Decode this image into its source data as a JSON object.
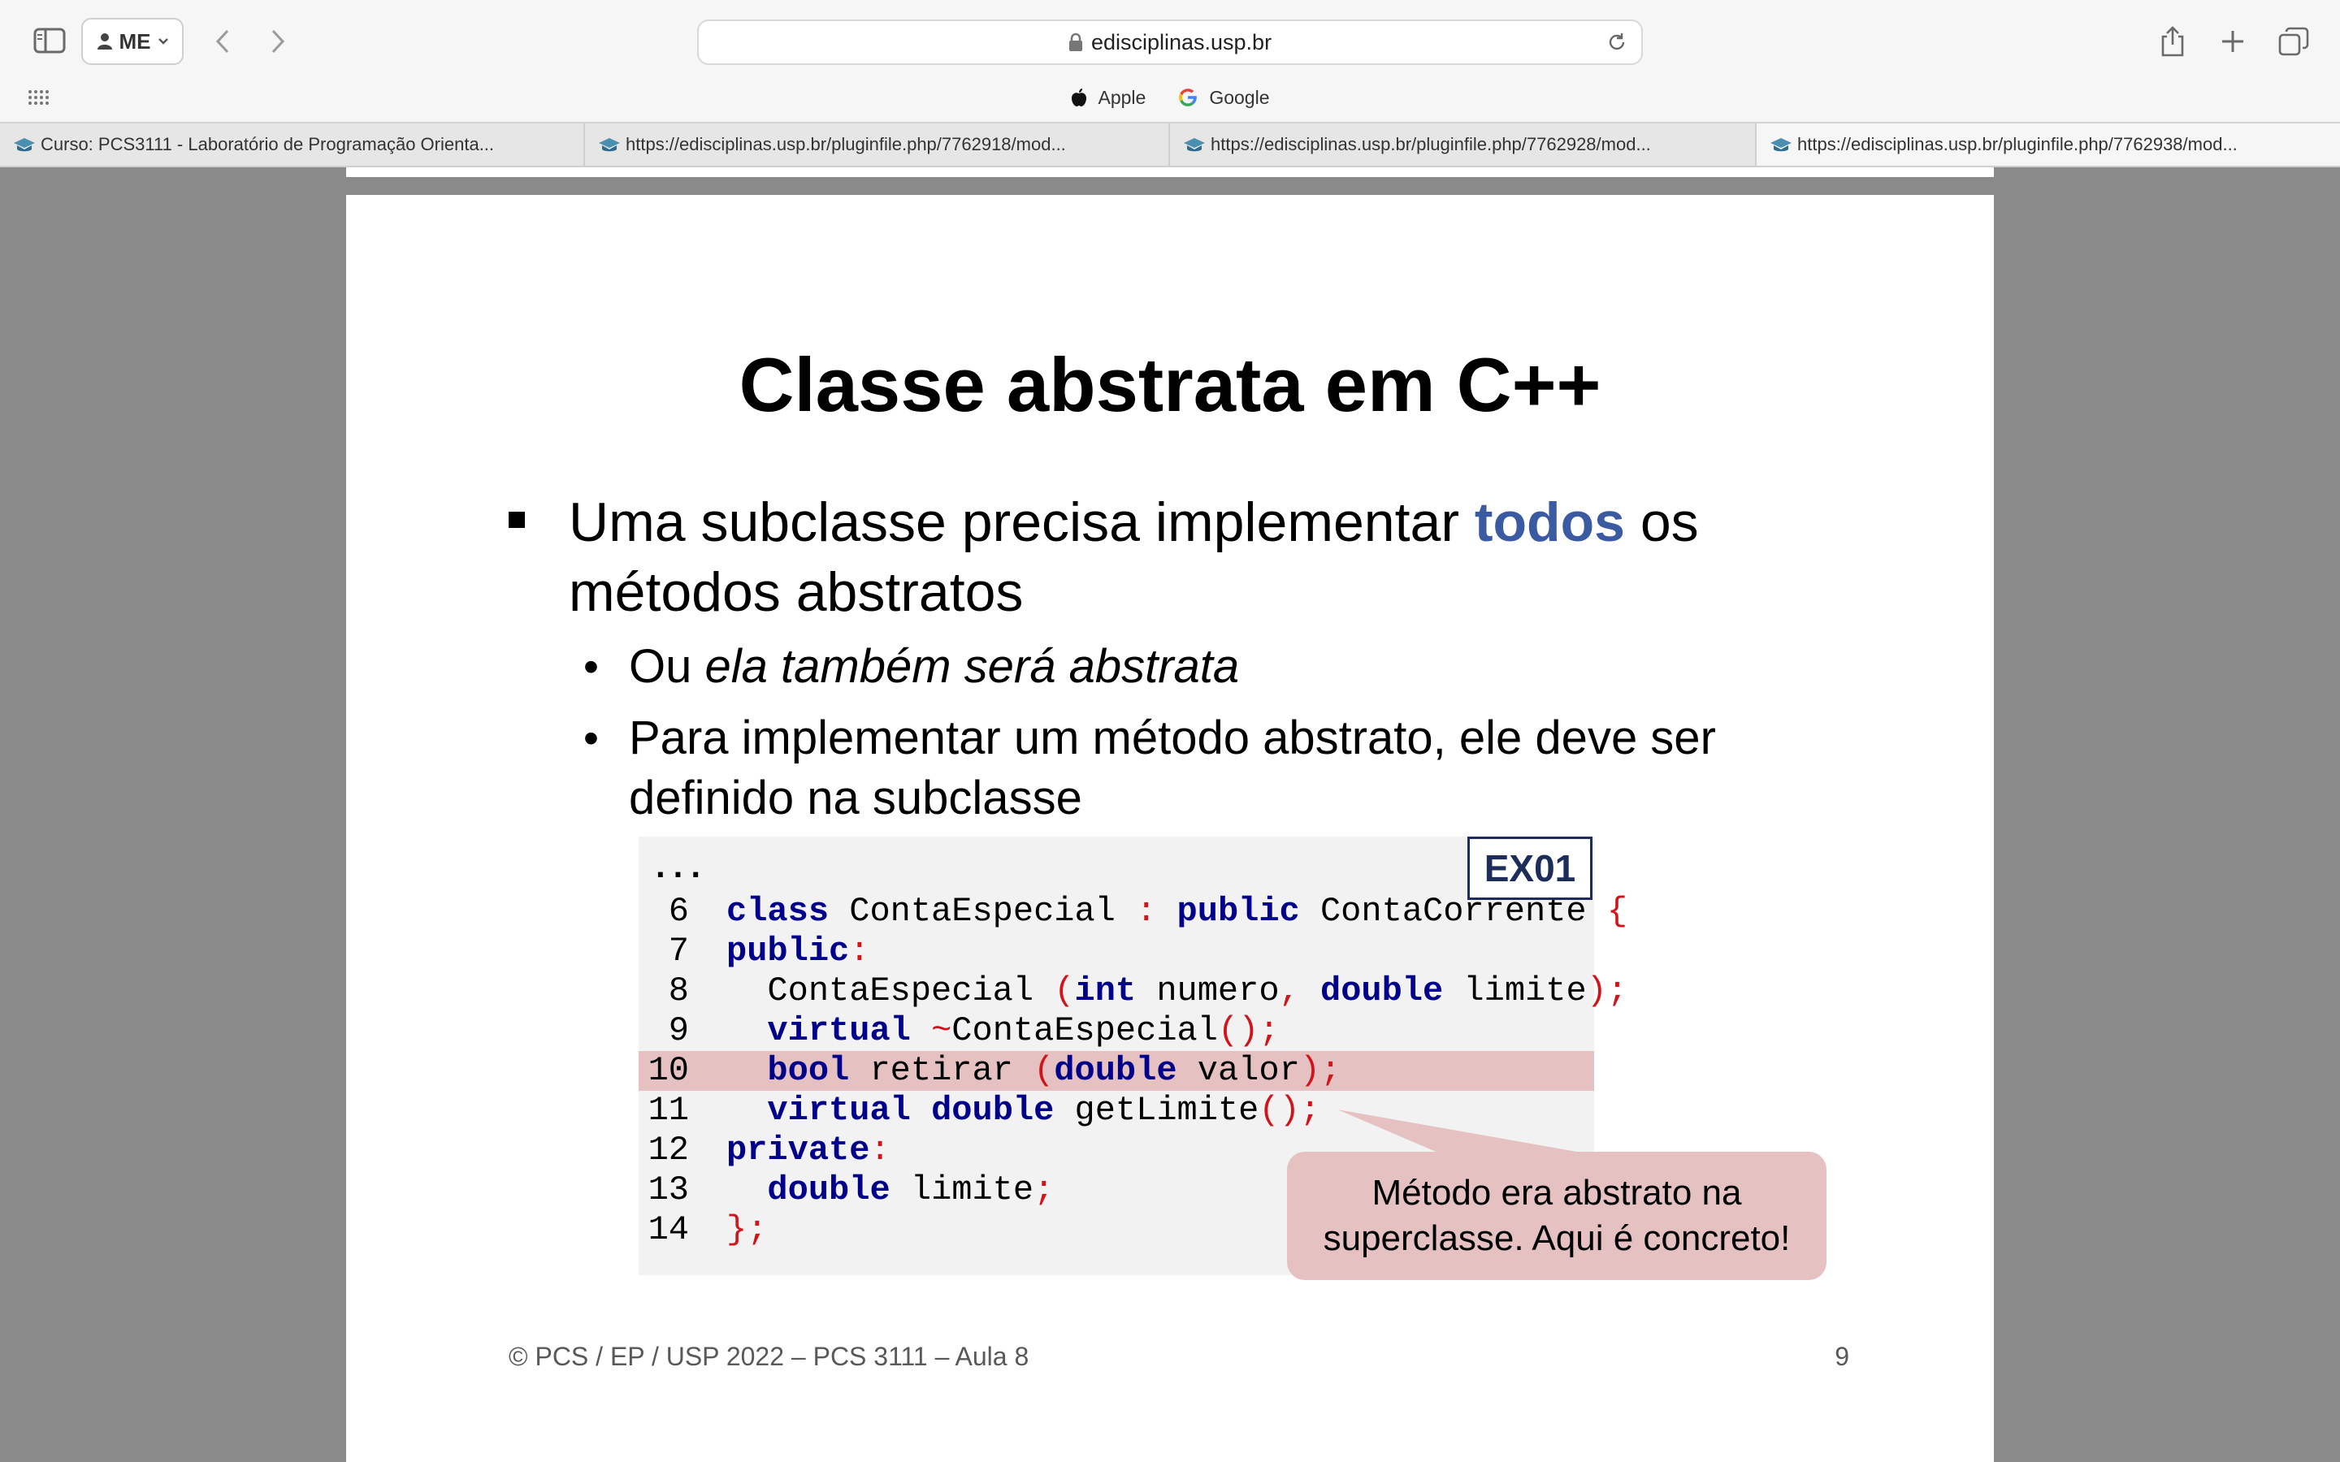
{
  "browser": {
    "profile_label": "ME",
    "url": "edisciplinas.usp.br",
    "favorites": [
      {
        "label": "Apple",
        "icon": "apple-icon"
      },
      {
        "label": "Google",
        "icon": "google-icon"
      }
    ],
    "tabs": [
      {
        "label": "Curso: PCS3111 - Laboratório de Programação Orienta...",
        "active": false
      },
      {
        "label": "https://edisciplinas.usp.br/pluginfile.php/7762918/mod...",
        "active": false
      },
      {
        "label": "https://edisciplinas.usp.br/pluginfile.php/7762928/mod...",
        "active": false
      },
      {
        "label": "https://edisciplinas.usp.br/pluginfile.php/7762938/mod...",
        "active": true
      }
    ]
  },
  "slide": {
    "title": "Classe abstrata em C++",
    "bullet1_pre": "Uma subclasse precisa implementar ",
    "bullet1_highlight": "todos",
    "bullet1_post": " os métodos abstratos",
    "bullet2_pre": "Ou ",
    "bullet2_italic": "ela também será abstrata",
    "bullet3": "Para implementar um método abstrato, ele deve ser definido na subclasse",
    "example_label": "EX01",
    "code_ellipsis": "...",
    "code_lines": [
      {
        "num": "6",
        "highlight": false,
        "tokens": [
          {
            "t": "class",
            "c": "kw"
          },
          {
            "t": " ContaEspecial "
          },
          {
            "t": ":",
            "c": "p"
          },
          {
            "t": " "
          },
          {
            "t": "public",
            "c": "kw"
          },
          {
            "t": " ContaCorrente "
          },
          {
            "t": "{",
            "c": "p"
          }
        ]
      },
      {
        "num": "7",
        "highlight": false,
        "tokens": [
          {
            "t": "public",
            "c": "kw"
          },
          {
            "t": ":",
            "c": "p"
          }
        ]
      },
      {
        "num": "8",
        "highlight": false,
        "tokens": [
          {
            "t": "  ContaEspecial "
          },
          {
            "t": "(",
            "c": "p"
          },
          {
            "t": "int",
            "c": "kw"
          },
          {
            "t": " numero"
          },
          {
            "t": ",",
            "c": "p"
          },
          {
            "t": " "
          },
          {
            "t": "double",
            "c": "kw"
          },
          {
            "t": " limite"
          },
          {
            "t": ");",
            "c": "p"
          }
        ]
      },
      {
        "num": "9",
        "highlight": false,
        "tokens": [
          {
            "t": "  "
          },
          {
            "t": "virtual",
            "c": "kw"
          },
          {
            "t": " "
          },
          {
            "t": "~",
            "c": "p"
          },
          {
            "t": "ContaEspecial"
          },
          {
            "t": "();",
            "c": "p"
          }
        ]
      },
      {
        "num": "10",
        "highlight": true,
        "tokens": [
          {
            "t": "  "
          },
          {
            "t": "bool",
            "c": "kw"
          },
          {
            "t": " retirar "
          },
          {
            "t": "(",
            "c": "p"
          },
          {
            "t": "double",
            "c": "kw"
          },
          {
            "t": " valor"
          },
          {
            "t": ");",
            "c": "p"
          }
        ]
      },
      {
        "num": "11",
        "highlight": false,
        "tokens": [
          {
            "t": "  "
          },
          {
            "t": "virtual",
            "c": "kw"
          },
          {
            "t": " "
          },
          {
            "t": "double",
            "c": "kw"
          },
          {
            "t": " getLimite"
          },
          {
            "t": "();",
            "c": "p"
          }
        ]
      },
      {
        "num": "12",
        "highlight": false,
        "tokens": [
          {
            "t": "private",
            "c": "kw"
          },
          {
            "t": ":",
            "c": "p"
          }
        ]
      },
      {
        "num": "13",
        "highlight": false,
        "tokens": [
          {
            "t": "  "
          },
          {
            "t": "double",
            "c": "kw"
          },
          {
            "t": " limite"
          },
          {
            "t": ";",
            "c": "p"
          }
        ]
      },
      {
        "num": "14",
        "highlight": false,
        "tokens": [
          {
            "t": "};",
            "c": "p"
          }
        ]
      }
    ],
    "callout": "Método era abstrato na superclasse. Aqui é concreto!",
    "footer_left": "© PCS / EP / USP 2022 – PCS 3111 – Aula 8",
    "page_number": "9"
  },
  "colors": {
    "highlight_word": "#3a5ba2",
    "code_keyword": "#00008b",
    "code_punct": "#d1141a",
    "code_highlight_row": "#e5c1c2",
    "callout_bg": "#e5c1c2",
    "viewer_bg": "#8a8a8a"
  }
}
